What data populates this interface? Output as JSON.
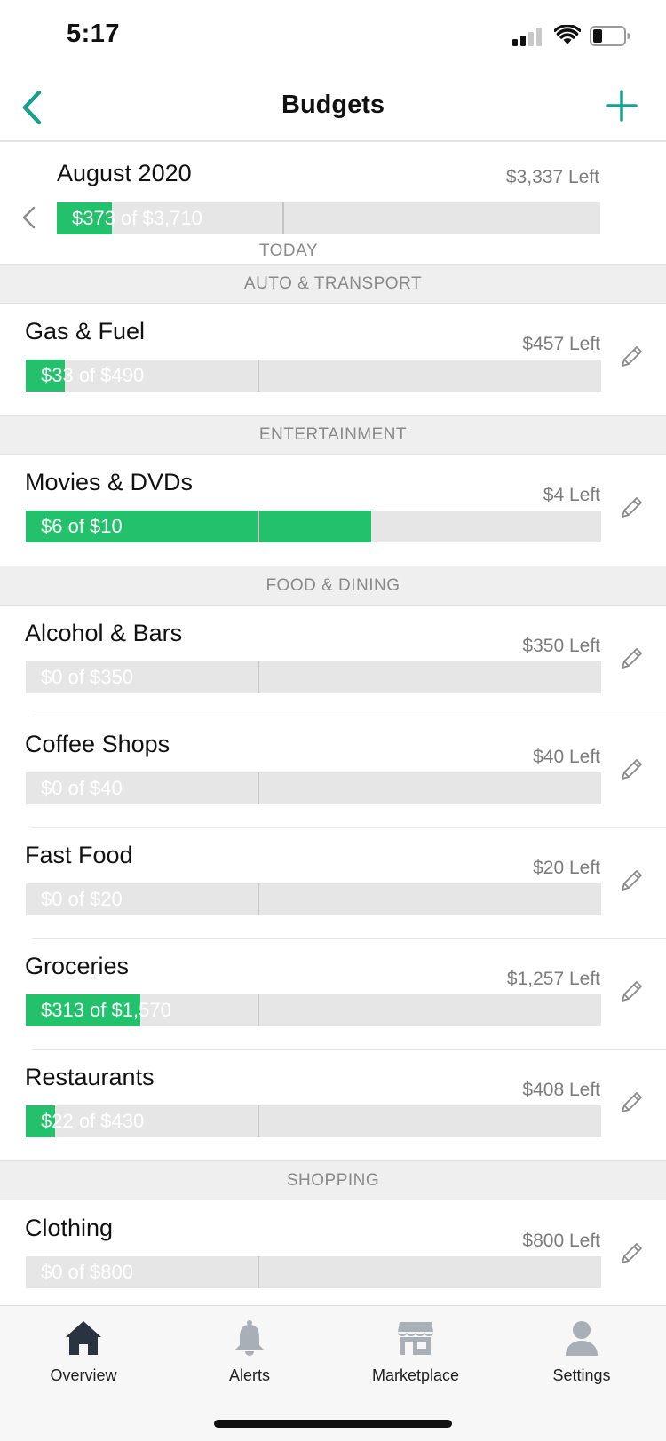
{
  "status_bar": {
    "time": "5:17"
  },
  "nav": {
    "title": "Budgets",
    "back_icon": "chevron-left-icon",
    "add_icon": "plus-icon",
    "accent_color": "#1a9e8f"
  },
  "month": {
    "title": "August 2020",
    "left": "$3,337 Left",
    "bar_text": "$373 of $3,710",
    "spent": 373,
    "budget": 3710,
    "today_label": "TODAY"
  },
  "colors": {
    "fill": "#23c16b",
    "track": "#e6e6e6",
    "section_bg": "#efefef",
    "muted_text": "#7c7c7c"
  },
  "sections": [
    {
      "title": "AUTO & TRANSPORT",
      "items": [
        {
          "name": "Gas & Fuel",
          "left": "$457 Left",
          "bar_text": "$33 of $490",
          "spent": 33,
          "budget": 490
        }
      ]
    },
    {
      "title": "ENTERTAINMENT",
      "items": [
        {
          "name": "Movies & DVDs",
          "left": "$4 Left",
          "bar_text": "$6 of $10",
          "spent": 6,
          "budget": 10
        }
      ]
    },
    {
      "title": "FOOD & DINING",
      "items": [
        {
          "name": "Alcohol & Bars",
          "left": "$350 Left",
          "bar_text": "$0 of $350",
          "spent": 0,
          "budget": 350
        },
        {
          "name": "Coffee Shops",
          "left": "$40 Left",
          "bar_text": "$0 of $40",
          "spent": 0,
          "budget": 40
        },
        {
          "name": "Fast Food",
          "left": "$20 Left",
          "bar_text": "$0 of $20",
          "spent": 0,
          "budget": 20
        },
        {
          "name": "Groceries",
          "left": "$1,257 Left",
          "bar_text": "$313 of $1,570",
          "spent": 313,
          "budget": 1570
        },
        {
          "name": "Restaurants",
          "left": "$408 Left",
          "bar_text": "$22 of $430",
          "spent": 22,
          "budget": 430
        }
      ]
    },
    {
      "title": "SHOPPING",
      "items": [
        {
          "name": "Clothing",
          "left": "$800 Left",
          "bar_text": "$0 of $800",
          "spent": 0,
          "budget": 800
        }
      ]
    }
  ],
  "tabs": [
    {
      "label": "Overview",
      "icon": "home-icon",
      "active": true
    },
    {
      "label": "Alerts",
      "icon": "bell-icon",
      "active": false
    },
    {
      "label": "Marketplace",
      "icon": "store-icon",
      "active": false
    },
    {
      "label": "Settings",
      "icon": "user-icon",
      "active": false
    }
  ]
}
